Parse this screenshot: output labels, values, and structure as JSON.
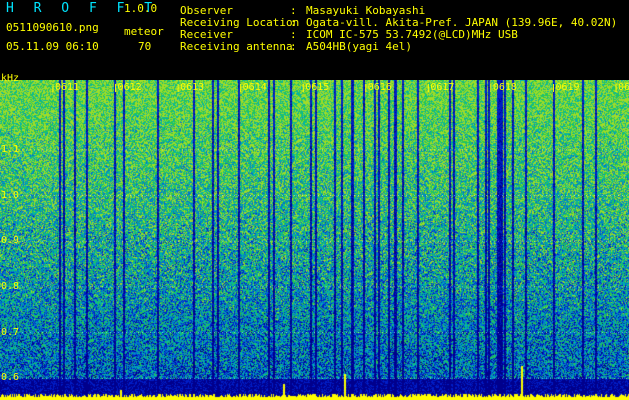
{
  "header": {
    "app_name": "H R O F F T",
    "version": "1.0.0",
    "filename": "0511090610.png",
    "meteor_label": "meteor",
    "meteor_count": "70",
    "datetime": "05.11.09 06:10"
  },
  "info": [
    {
      "label": "Observer",
      "value": "Masayuki Kobayashi"
    },
    {
      "label": "Receiving Location",
      "value": "Ogata-vill. Akita-Pref. JAPAN (139.96E, 40.02N)"
    },
    {
      "label": "Receiver",
      "value": "ICOM IC-575 53.7492(@LCD)MHz USB"
    },
    {
      "label": "Receiving antenna",
      "value": "A504HB(yagi 4el)"
    }
  ],
  "info_colon": ":",
  "spectrogram": {
    "y_unit": "kHz",
    "y_ticks": [
      "1.1",
      "1.0",
      "0.9",
      "0.8",
      "0.7",
      "0.6"
    ],
    "y_range": [
      0.57,
      1.22
    ],
    "time_ticks": [
      "0611",
      "0612",
      "0613",
      "0614",
      "0615",
      "0616",
      "0617",
      "0618",
      "0619",
      "0620"
    ],
    "colors": {
      "background": "#00008c",
      "text": "#ffff00",
      "accent": "#00e5ff"
    }
  }
}
